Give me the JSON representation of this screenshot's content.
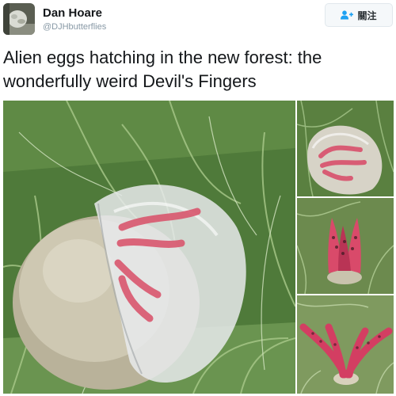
{
  "user": {
    "name": "Dan Hoare",
    "handle": "@DJHbutterflies"
  },
  "follow_button": {
    "label": "關注",
    "icon": "add-user-icon"
  },
  "tweet": {
    "text": "Alien eggs hatching in the new forest: the wonderfully weird Devil's Fingers"
  },
  "colors": {
    "link_blue": "#1da1f2",
    "name_text": "#14171a",
    "handle_text": "#8899a6"
  }
}
